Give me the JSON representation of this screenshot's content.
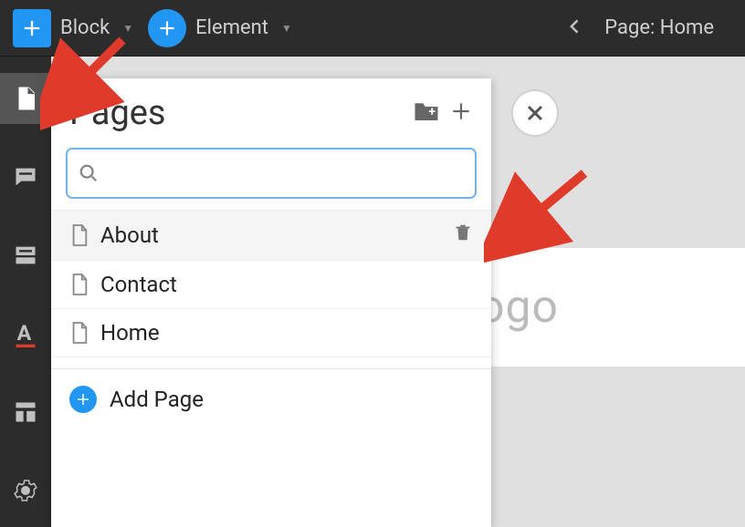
{
  "topbar": {
    "block_label": "Block",
    "element_label": "Element",
    "page_prefix": "Page:",
    "current_page": "Home"
  },
  "panel": {
    "title": "Pages",
    "search_placeholder": "",
    "search_value": ""
  },
  "pages": [
    {
      "name": "About",
      "has_trash": true
    },
    {
      "name": "Contact",
      "has_trash": false
    },
    {
      "name": "Home",
      "has_trash": false
    }
  ],
  "add_page_label": "Add Page",
  "canvas": {
    "logo_fragment": "ogo"
  },
  "colors": {
    "accent": "#2196f3",
    "arrow": "#e03b2a",
    "dark": "#2c2c2c"
  }
}
